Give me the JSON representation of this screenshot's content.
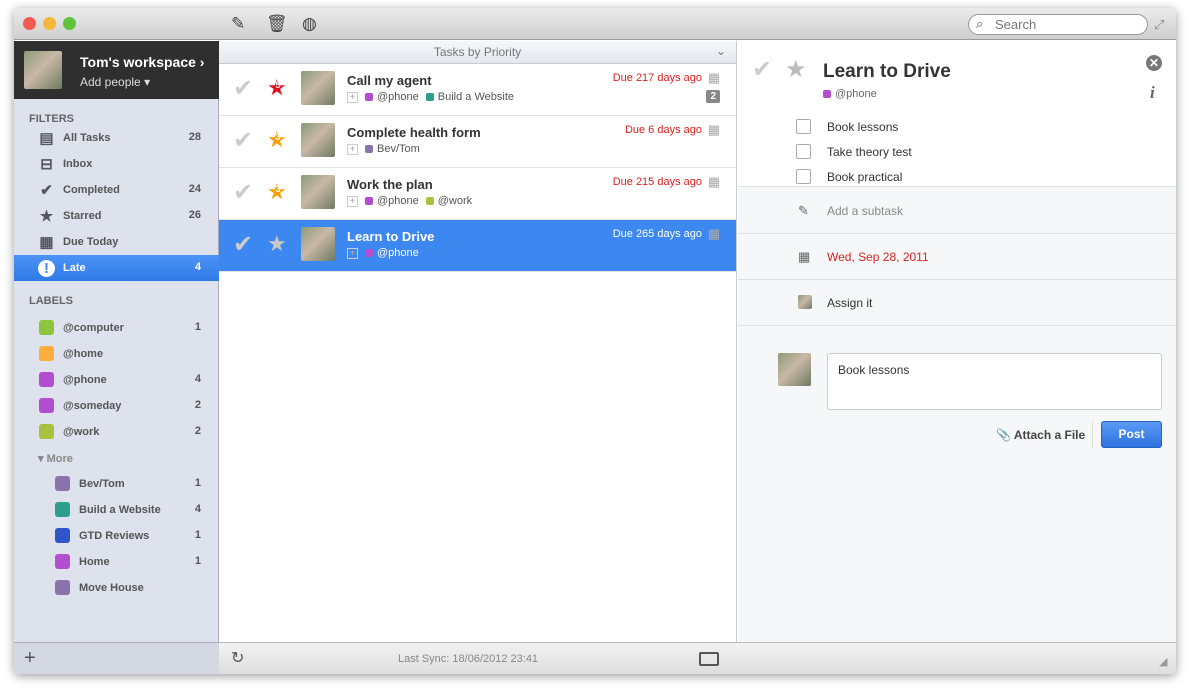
{
  "toolbar": {
    "search_placeholder": "Search",
    "icons": [
      "compose-icon",
      "trash-icon",
      "globe-icon"
    ]
  },
  "workspace": {
    "name": "Tom's workspace",
    "add_people": "Add people"
  },
  "sidebar": {
    "filters_title": "FILTERS",
    "filters": [
      {
        "label": "All Tasks",
        "count": "28",
        "icon": "all-tasks-icon"
      },
      {
        "label": "Inbox",
        "count": "",
        "icon": "inbox-icon"
      },
      {
        "label": "Completed",
        "count": "24",
        "icon": "check-icon"
      },
      {
        "label": "Starred",
        "count": "26",
        "icon": "star-icon"
      },
      {
        "label": "Due Today",
        "count": "",
        "icon": "calendar-icon"
      },
      {
        "label": "Late",
        "count": "4",
        "icon": "exclamation-icon",
        "selected": true
      }
    ],
    "labels_title": "LABELS",
    "labels": [
      {
        "label": "@computer",
        "count": "1",
        "color": "#8cc63f"
      },
      {
        "label": "@home",
        "count": "",
        "color": "#fbae3c"
      },
      {
        "label": "@phone",
        "count": "4",
        "color": "#b24fd0"
      },
      {
        "label": "@someday",
        "count": "2",
        "color": "#b24fd0"
      },
      {
        "label": "@work",
        "count": "2",
        "color": "#aac13f"
      }
    ],
    "more": "More",
    "projects": [
      {
        "label": "Bev/Tom",
        "count": "1",
        "color": "#8a73a8"
      },
      {
        "label": "Build a Website",
        "count": "4",
        "color": "#2e9d8e"
      },
      {
        "label": "GTD Reviews",
        "count": "1",
        "color": "#2f55c9"
      },
      {
        "label": "Home",
        "count": "1",
        "color": "#b24fd0"
      },
      {
        "label": "Move House",
        "count": "",
        "color": "#8a73a8"
      }
    ]
  },
  "list": {
    "header": "Tasks by Priority",
    "tasks": [
      {
        "title": "Call my agent",
        "priority": "5",
        "star_color": "#e0101a",
        "due": "Due 217 days ago",
        "tags": [
          {
            "name": "@phone",
            "color": "#b24fd0"
          },
          {
            "name": "Build a Website",
            "color": "#2e9d8e"
          }
        ],
        "comments": "2"
      },
      {
        "title": "Complete health form",
        "priority": "3",
        "star_color": "#f5a000",
        "due": "Due 6 days ago",
        "tags": [
          {
            "name": "Bev/Tom",
            "color": "#8a73a8"
          }
        ]
      },
      {
        "title": "Work the plan",
        "priority": "3",
        "star_color": "#f5a000",
        "due": "Due 215 days ago",
        "tags": [
          {
            "name": "@phone",
            "color": "#b24fd0"
          },
          {
            "name": "@work",
            "color": "#aac13f"
          }
        ]
      },
      {
        "title": "Learn to Drive",
        "priority": "",
        "star_color": "#c8c8c8",
        "due": "Due 265 days ago",
        "tags": [
          {
            "name": "@phone",
            "color": "#b24fd0"
          }
        ],
        "selected": true
      }
    ]
  },
  "detail": {
    "title": "Learn to Drive",
    "tag": "@phone",
    "tag_color": "#b24fd0",
    "subtasks": [
      "Book lessons",
      "Take theory test",
      "Book practical"
    ],
    "add_subtask": "Add a subtask",
    "due_date": "Wed, Sep 28, 2011",
    "assign": "Assign it",
    "comment_value": "Book lessons",
    "attach": "Attach a File",
    "post": "Post"
  },
  "footer": {
    "last_sync": "Last Sync: 18/06/2012 23:41"
  },
  "colors": {
    "accent": "#3d87f0",
    "overdue": "#d22222"
  }
}
